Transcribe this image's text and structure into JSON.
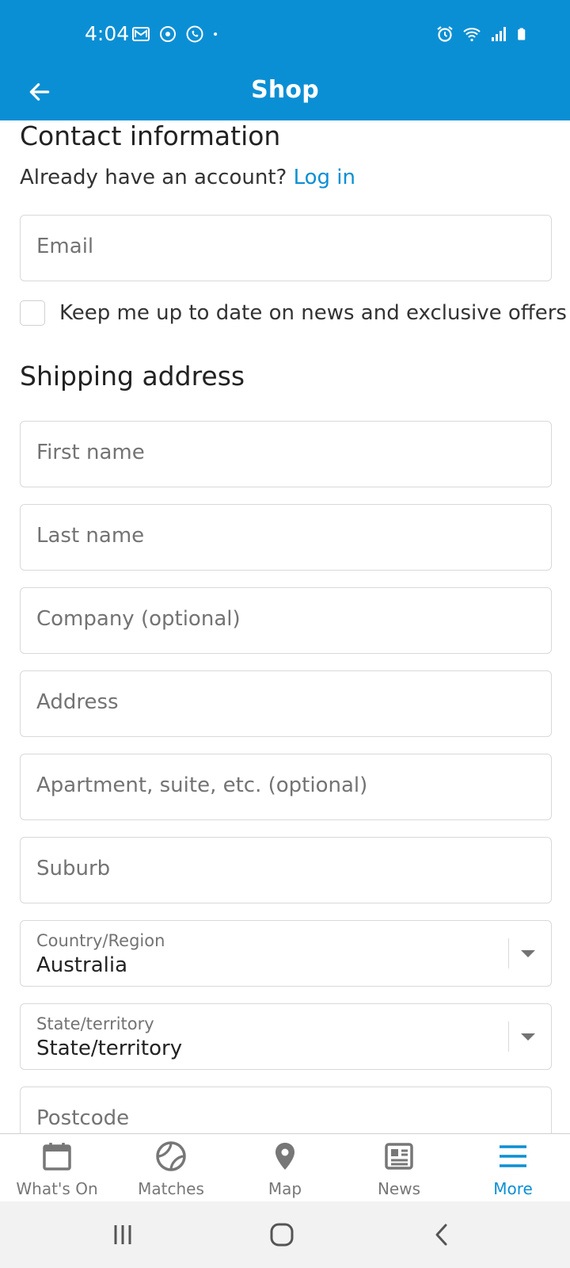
{
  "status_bar": {
    "time": "4:04",
    "left_icons": [
      "gmail-icon",
      "sync-icon",
      "whatsapp-icon",
      "dot-icon"
    ],
    "right_icons": [
      "alarm-icon",
      "wifi-icon",
      "signal-icon",
      "battery-icon"
    ]
  },
  "app_bar": {
    "title": "Shop",
    "back_icon": "arrow-left-icon"
  },
  "contact": {
    "title": "Contact information",
    "already_text": "Already have an account?",
    "login_link": "Log in",
    "email_placeholder": "Email",
    "newsletter_label": "Keep me up to date on news and exclusive offers"
  },
  "shipping": {
    "title": "Shipping address",
    "first_name_placeholder": "First name",
    "last_name_placeholder": "Last name",
    "company_placeholder": "Company (optional)",
    "address_placeholder": "Address",
    "apartment_placeholder": "Apartment, suite, etc. (optional)",
    "suburb_placeholder": "Suburb",
    "country": {
      "label": "Country/Region",
      "value": "Australia"
    },
    "state": {
      "label": "State/territory",
      "value": "State/territory"
    },
    "postcode_placeholder": "Postcode"
  },
  "bottom_nav": {
    "items": [
      {
        "label": "What's On",
        "icon": "calendar-icon"
      },
      {
        "label": "Matches",
        "icon": "tennis-ball-icon"
      },
      {
        "label": "Map",
        "icon": "map-pin-icon"
      },
      {
        "label": "News",
        "icon": "newspaper-icon"
      },
      {
        "label": "More",
        "icon": "menu-icon"
      }
    ],
    "active_index": 4
  },
  "colors": {
    "brand": "#0b8fd4",
    "placeholder": "#737373",
    "border": "#d9d9d9"
  }
}
